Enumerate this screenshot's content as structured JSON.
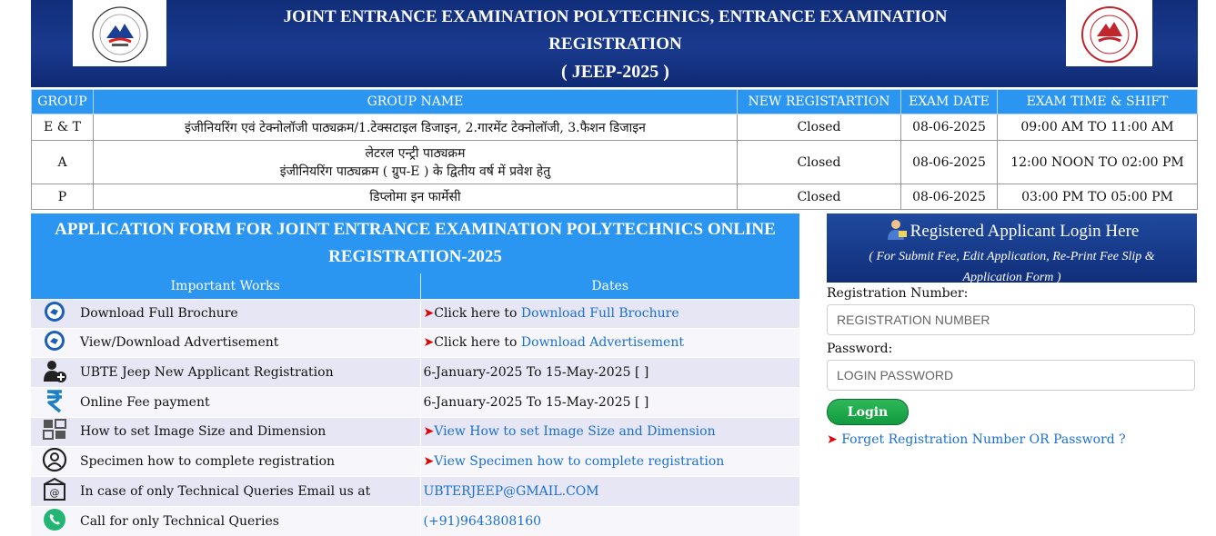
{
  "header": {
    "title_line1": "JOINT ENTRANCE EXAMINATION POLYTECHNICS, ENTRANCE EXAMINATION",
    "title_line2": "REGISTRATION",
    "title_line3": "( JEEP-2025 )"
  },
  "groups_table": {
    "headers": [
      "GROUP",
      "GROUP NAME",
      "NEW REGISTARTION",
      "EXAM DATE",
      "EXAM TIME & SHIFT"
    ],
    "rows": [
      {
        "group": "E & T",
        "name_line1": "इंजीनियरिंग एवं टेक्नोलॉजी पाठ्यक्रम/1.टेक्सटाइल डिजाइन, 2.गारमेंट टेक्नोलॉजी, 3.फैशन डिजाइन",
        "name_line2": "",
        "registration": "Closed",
        "date": "08-06-2025",
        "time": "09:00 AM TO 11:00 AM"
      },
      {
        "group": "A",
        "name_line1": "लेटरल एन्ट्री पाठ्यक्रम",
        "name_line2": "इंजीनियरिंग पाठ्यक्रम ( ग्रुप-E ) के द्वितीय वर्ष में प्रवेश हेतु",
        "registration": "Closed",
        "date": "08-06-2025",
        "time": "12:00 NOON TO 02:00 PM"
      },
      {
        "group": "P",
        "name_line1": "डिप्लोमा इन फार्मेसी",
        "name_line2": "",
        "registration": "Closed",
        "date": "08-06-2025",
        "time": "03:00 PM TO 05:00 PM"
      }
    ]
  },
  "application": {
    "title_line1": "APPLICATION FORM FOR JOINT ENTRANCE EXAMINATION POLYTECHNICS ONLINE",
    "title_line2": "REGISTRATION-2025",
    "col_works": "Important Works",
    "col_dates": "Dates",
    "rows": [
      {
        "icon": "brochure-icon",
        "work": "Download Full Brochure",
        "arrow": "➤",
        "prefix": "Click here to ",
        "value": "Download Full Brochure",
        "is_link": true
      },
      {
        "icon": "advertisement-icon",
        "work": "View/Download Advertisement",
        "arrow": "➤",
        "prefix": "Click here to ",
        "value": "Download Advertisement",
        "is_link": true
      },
      {
        "icon": "add-user-icon",
        "work": "UBTE Jeep New Applicant Registration",
        "arrow": "",
        "prefix": "",
        "value": "6-January-2025 To 15-May-2025 [ ]",
        "is_link": false
      },
      {
        "icon": "rupee-icon",
        "work": "Online Fee payment",
        "arrow": "",
        "prefix": "",
        "value": "6-January-2025 To 15-May-2025 [ ]",
        "is_link": false
      },
      {
        "icon": "image-size-icon",
        "work": "How to set Image Size and Dimension",
        "arrow": "➤",
        "prefix": "",
        "value": "View How to set Image Size and Dimension",
        "is_link": true
      },
      {
        "icon": "user-circle-icon",
        "work": "Specimen how to complete registration",
        "arrow": "➤",
        "prefix": "",
        "value": "View Specimen how to complete registration",
        "is_link": true
      },
      {
        "icon": "email-icon",
        "work": "In case of only Technical Queries Email us at",
        "arrow": "",
        "prefix": "",
        "value": "UBTERJEEP@GMAIL.COM",
        "is_link": true
      },
      {
        "icon": "phone-icon",
        "work": "Call for only Technical Queries",
        "arrow": "",
        "prefix": "",
        "value": "(+91)9643808160",
        "is_link": true
      }
    ]
  },
  "login": {
    "title": "Registered Applicant Login Here",
    "subtitle": "( For Submit Fee, Edit Application, Re-Print Fee Slip & Application Form )",
    "reg_label": "Registration Number:",
    "reg_placeholder": "REGISTRATION NUMBER",
    "pwd_label": "Password:",
    "pwd_placeholder": "LOGIN PASSWORD",
    "button": "Login",
    "forgot_arrow": "➤",
    "forgot": "Forget Registration Number OR Password ?"
  },
  "colors": {
    "header_navy": "#112e7a",
    "table_header_blue": "#2a96f2",
    "link_blue": "#1a6fd0",
    "arrow_red": "#e30000",
    "login_green": "#129b3f"
  }
}
